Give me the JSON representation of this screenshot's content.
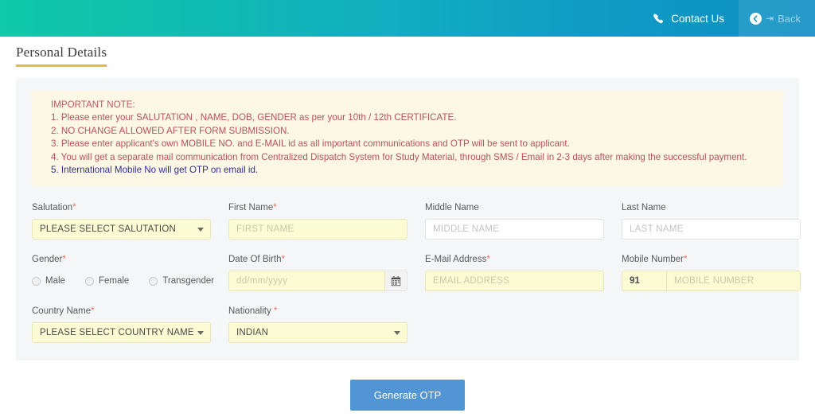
{
  "topbar": {
    "contact_label": "Contact Us",
    "contact_icon": "phone-icon",
    "back_label": "Back",
    "back_icon": "circle-left-arrow-icon",
    "logout_icon": "sign-out-icon",
    "gradient_start": "#0fc9a9",
    "gradient_end": "#0d8ec2"
  },
  "page": {
    "title": "Personal Details",
    "title_underline_color": "#e0bc45"
  },
  "note": {
    "background": "#fdf7e6",
    "lines": [
      {
        "text": "IMPORTANT NOTE:",
        "color": "#c4575f"
      },
      {
        "text": "1. Please enter your SALUTATION , NAME, DOB, GENDER as per your 10th / 12th CERTIFICATE.",
        "color": "#b9515b"
      },
      {
        "text": "2. NO CHANGE ALLOWED AFTER FORM SUBMISSION.",
        "color": "#b9515b"
      },
      {
        "text": "3. Please enter applicant's own MOBILE NO. and E-MAIL id as all important communications and OTP will be sent to applicant.",
        "color": "#b9515b"
      },
      {
        "text": "4. You will get a separate mail communication from Centralized Dispatch System for Study Material, through SMS / Email in 2-3 days after making the successful payment.",
        "color": "#b9515b"
      },
      {
        "text": "5. International Mobile No will get OTP on email id.",
        "color": "#2f2f93"
      }
    ]
  },
  "form": {
    "required_marker": "*",
    "salutation": {
      "label": "Salutation",
      "required": true,
      "value": "PLEASE SELECT SALUTATION",
      "caret_icon": "chevron-down-icon"
    },
    "first_name": {
      "label": "First Name",
      "required": true,
      "value": "",
      "placeholder": "FIRST NAME"
    },
    "middle_name": {
      "label": "Middle Name",
      "required": false,
      "value": "",
      "placeholder": "MIDDLE NAME"
    },
    "last_name": {
      "label": "Last Name",
      "required": false,
      "value": "",
      "placeholder": "LAST NAME"
    },
    "gender": {
      "label": "Gender",
      "required": true,
      "selected": "",
      "options": [
        "Male",
        "Female",
        "Transgender"
      ]
    },
    "dob": {
      "label": "Date Of Birth",
      "required": true,
      "value": "",
      "placeholder": "dd/mm/yyyy",
      "button_icon": "calendar-icon"
    },
    "email": {
      "label": "E-Mail Address",
      "required": true,
      "value": "",
      "placeholder": "EMAIL ADDRESS"
    },
    "mobile": {
      "label": "Mobile Number",
      "required": true,
      "country_code": "91",
      "value": "",
      "placeholder": "MOBILE NUMBER"
    },
    "country_name": {
      "label": "Country Name",
      "required": true,
      "value": "PLEASE SELECT COUNTRY NAME",
      "caret_icon": "chevron-down-icon"
    },
    "nationality": {
      "label": "Nationality",
      "required": true,
      "value": "INDIAN",
      "caret_icon": "chevron-down-icon"
    }
  },
  "footer": {
    "generate_otp_label": "Generate OTP",
    "button_color": "#5295d4"
  }
}
